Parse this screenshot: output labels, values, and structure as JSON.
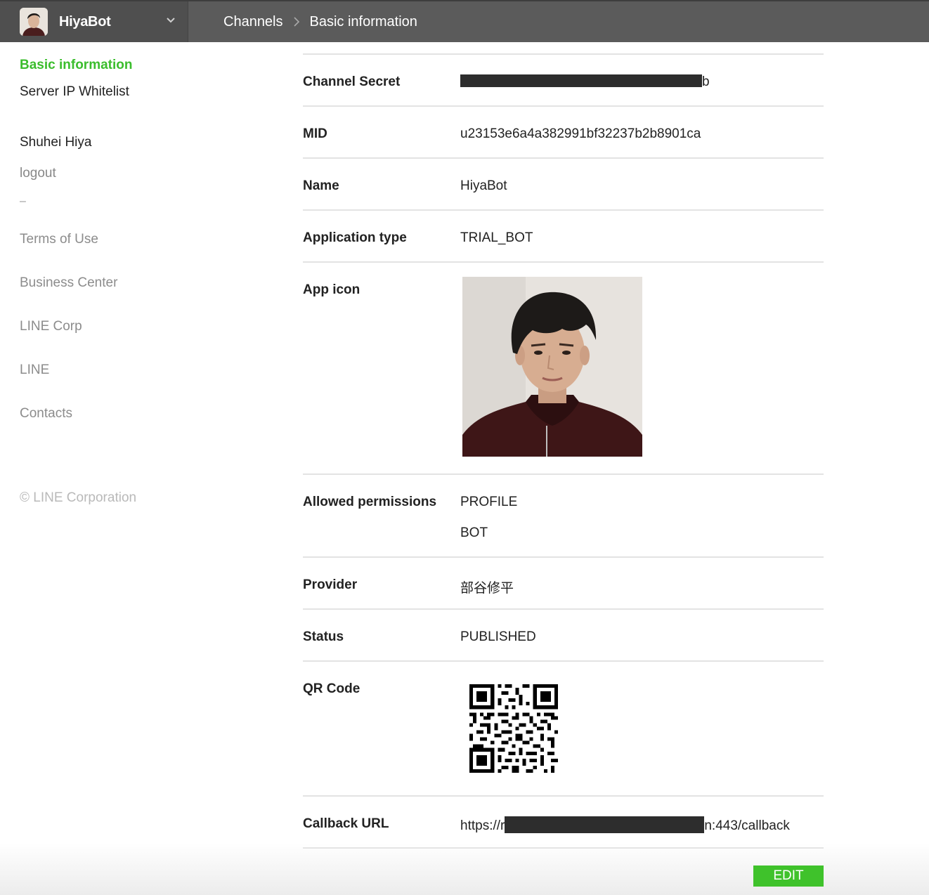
{
  "header": {
    "account_name": "HiyaBot",
    "breadcrumb": [
      "Channels",
      "Basic information"
    ]
  },
  "sidebar": {
    "nav": [
      "Basic information",
      "Server IP Whitelist"
    ],
    "user_name": "Shuhei Hiya",
    "logout": "logout",
    "divider": "–",
    "links": [
      "Terms of Use",
      "Business Center",
      "LINE Corp",
      "LINE",
      "Contacts"
    ],
    "copyright": "© LINE Corporation"
  },
  "fields": {
    "channel_secret": {
      "label": "Channel Secret",
      "value_suffix": "b"
    },
    "mid": {
      "label": "MID",
      "value": "u23153e6a4a382991bf32237b2b8901ca"
    },
    "name": {
      "label": "Name",
      "value": "HiyaBot"
    },
    "application_type": {
      "label": "Application type",
      "value": "TRIAL_BOT"
    },
    "app_icon": {
      "label": "App icon"
    },
    "allowed_permissions": {
      "label": "Allowed permissions",
      "values": [
        "PROFILE",
        "BOT"
      ]
    },
    "provider": {
      "label": "Provider",
      "value": "部谷修平"
    },
    "status": {
      "label": "Status",
      "value": "PUBLISHED"
    },
    "qr_code": {
      "label": "QR Code"
    },
    "callback_url": {
      "label": "Callback URL",
      "prefix": "https://r",
      "suffix": "n:443/callback"
    }
  },
  "actions": {
    "edit": "EDIT"
  },
  "colors": {
    "accent": "#3bbd2d",
    "topbar": "#5b5b5b",
    "button": "#3fc22b"
  }
}
